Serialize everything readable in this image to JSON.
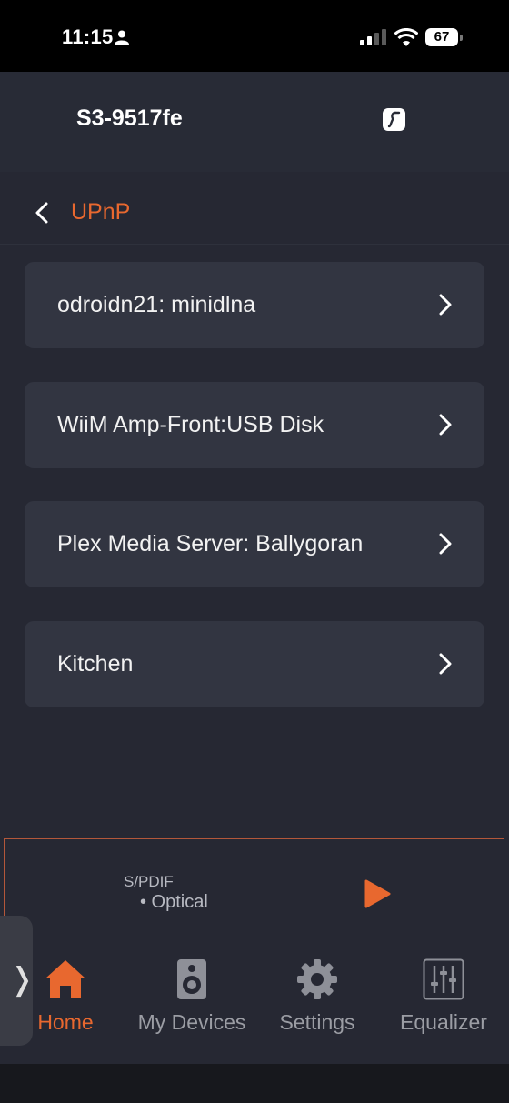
{
  "status_bar": {
    "time": "11:15",
    "battery": "67"
  },
  "header": {
    "device_name": "S3-9517fe",
    "icon": "music-note-icon"
  },
  "breadcrumb": {
    "label": "UPnP"
  },
  "sources": [
    {
      "label": "odroidn21: minidlna"
    },
    {
      "label": "WiiM Amp-Front:USB Disk"
    },
    {
      "label": "Plex Media Server: Ballygoran"
    },
    {
      "label": "Kitchen"
    }
  ],
  "player": {
    "source": "S/PDIF",
    "input": "• Optical"
  },
  "nav": [
    {
      "label": "Home",
      "icon": "home-icon",
      "active": true
    },
    {
      "label": "My Devices",
      "icon": "speaker-icon"
    },
    {
      "label": "Settings",
      "icon": "gear-icon"
    },
    {
      "label": "Equalizer",
      "icon": "equalizer-icon"
    }
  ],
  "colors": {
    "accent": "#e8682f",
    "background": "#262833",
    "card": "#323541"
  }
}
